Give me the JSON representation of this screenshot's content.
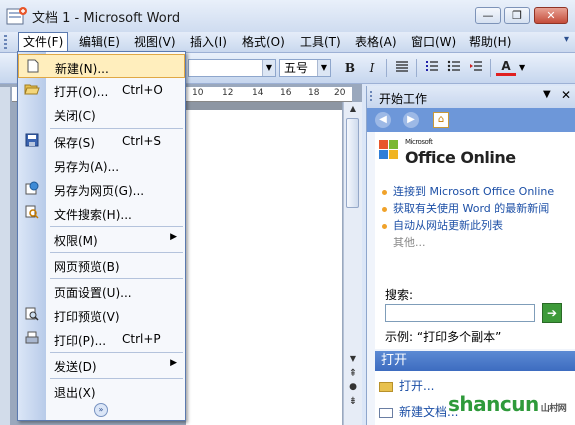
{
  "window": {
    "title": "文档 1 - Microsoft Word",
    "minimize": "—",
    "maximize": "❐",
    "close": "✕"
  },
  "menubar": [
    "文件(F)",
    "编辑(E)",
    "视图(V)",
    "插入(I)",
    "格式(O)",
    "工具(T)",
    "表格(A)",
    "窗口(W)",
    "帮助(H)"
  ],
  "toolbar": {
    "font_size": "五号",
    "bold": "B",
    "italic": "I",
    "font_color": "A"
  },
  "ruler": {
    "ticks": [
      "10",
      "12",
      "14",
      "16",
      "18",
      "20"
    ]
  },
  "file_menu": {
    "items": [
      {
        "label": "新建(N)...",
        "shortcut": "",
        "icon": "new-doc-icon"
      },
      {
        "label": "打开(O)...",
        "shortcut": "Ctrl+O",
        "icon": "open-folder-icon"
      },
      {
        "label": "关闭(C)",
        "shortcut": "",
        "icon": ""
      },
      {
        "label": "保存(S)",
        "shortcut": "Ctrl+S",
        "icon": "save-icon"
      },
      {
        "label": "另存为(A)...",
        "shortcut": "",
        "icon": ""
      },
      {
        "label": "另存为网页(G)...",
        "shortcut": "",
        "icon": "web-page-icon"
      },
      {
        "label": "文件搜索(H)...",
        "shortcut": "",
        "icon": "file-search-icon"
      },
      {
        "label": "权限(M)",
        "shortcut": "",
        "icon": "",
        "submenu": true
      },
      {
        "label": "网页预览(B)",
        "shortcut": "",
        "icon": ""
      },
      {
        "label": "页面设置(U)...",
        "shortcut": "",
        "icon": ""
      },
      {
        "label": "打印预览(V)",
        "shortcut": "",
        "icon": "print-preview-icon"
      },
      {
        "label": "打印(P)...",
        "shortcut": "Ctrl+P",
        "icon": "print-icon"
      },
      {
        "label": "发送(D)",
        "shortcut": "",
        "icon": "",
        "submenu": true
      },
      {
        "label": "退出(X)",
        "shortcut": "",
        "icon": ""
      }
    ]
  },
  "task_pane": {
    "title": "开始工作",
    "microsoft": "Microsoft",
    "brand": "Office Online",
    "links": [
      "连接到 Microsoft Office Online",
      "获取有关使用 Word 的最新新闻",
      "自动从网站更新此列表",
      "其他..."
    ],
    "search_label": "搜索:",
    "search_value": "",
    "example": "示例: “打印多个副本”",
    "open_section": "打开",
    "open_item": "打开...",
    "open_item2": "新建文档..."
  },
  "watermark": {
    "text": "shancun",
    "sub": "山村网"
  },
  "colors": {
    "accent": "#3d6cc0",
    "highlight": "#ffeebd",
    "brand_orange": "#f0a22a"
  }
}
